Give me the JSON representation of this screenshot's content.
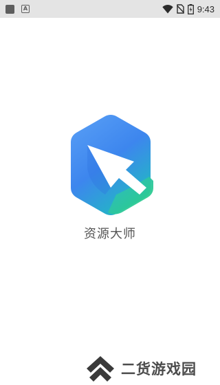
{
  "status_bar": {
    "left_icons": [
      "square-icon",
      "a-icon"
    ],
    "right_icons": [
      "wifi-icon",
      "no-sim-icon",
      "battery-icon"
    ],
    "time": "9:43"
  },
  "splash": {
    "app_name": "资源大师",
    "logo_colors": {
      "hex_top": "#4f8ef3",
      "hex_bottom": "#1fc7a0",
      "accent_green": "#27c16b"
    }
  },
  "watermark": {
    "text": "二货游戏园",
    "logo_color": "#3a3a3a"
  }
}
